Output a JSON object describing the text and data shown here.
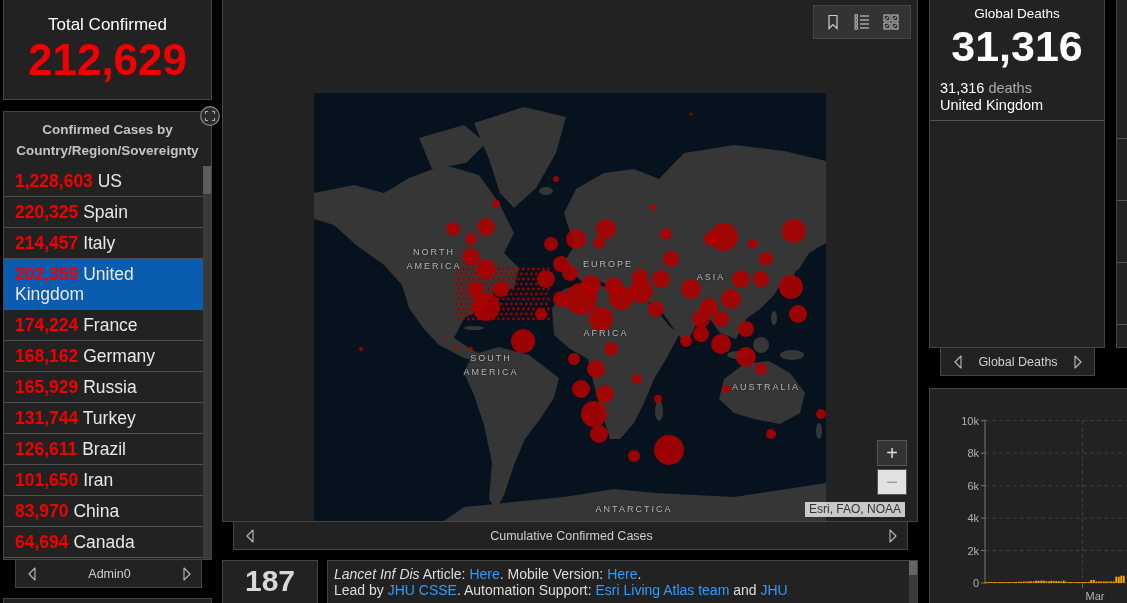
{
  "total_confirmed": {
    "label": "Total Confirmed",
    "value": "212,629"
  },
  "country_list": {
    "title": "Confirmed Cases by Country/Region/Sovereignty",
    "items": [
      {
        "count": "1,228,603",
        "name": "US",
        "selected": false
      },
      {
        "count": "220,325",
        "name": "Spain",
        "selected": false
      },
      {
        "count": "214,457",
        "name": "Italy",
        "selected": false
      },
      {
        "count": "202,359",
        "name": "United Kingdom",
        "selected": true
      },
      {
        "count": "174,224",
        "name": "France",
        "selected": false
      },
      {
        "count": "168,162",
        "name": "Germany",
        "selected": false
      },
      {
        "count": "165,929",
        "name": "Russia",
        "selected": false
      },
      {
        "count": "131,744",
        "name": "Turkey",
        "selected": false
      },
      {
        "count": "126,611",
        "name": "Brazil",
        "selected": false
      },
      {
        "count": "101,650",
        "name": "Iran",
        "selected": false
      },
      {
        "count": "83,970",
        "name": "China",
        "selected": false
      },
      {
        "count": "64,694",
        "name": "Canada",
        "selected": false
      }
    ],
    "tab": {
      "label": "Admin0"
    }
  },
  "map": {
    "labels": [
      "NORTH AMERICA",
      "EUROPE",
      "ASIA",
      "SOUTH AMERICA",
      "AFRICA",
      "AUSTRALIA",
      "ANTARCTICA"
    ],
    "zoom_buttons": [
      {
        "label": "+",
        "kind": "zoom-in"
      },
      {
        "label": "−",
        "kind": "zoom-out"
      }
    ],
    "attribution": "Esri, FAO, NOAA",
    "tab": {
      "label": "Cumulative Confirmed Cases"
    }
  },
  "bottom_count": {
    "value": "187"
  },
  "info_panel": {
    "lines": [
      [
        {
          "kind": "italic",
          "text": "Lancet Inf Dis"
        },
        {
          "kind": "plain",
          "text": " Article: "
        },
        {
          "kind": "link",
          "text": "Here"
        },
        {
          "kind": "plain",
          "text": ". Mobile Version: "
        },
        {
          "kind": "link",
          "text": "Here"
        },
        {
          "kind": "plain",
          "text": "."
        }
      ],
      [
        {
          "kind": "plain",
          "text": "Lead by "
        },
        {
          "kind": "link",
          "text": "JHU CSSE"
        },
        {
          "kind": "plain",
          "text": ". Automation Support: "
        },
        {
          "kind": "link",
          "text": "Esri Living Atlas team"
        },
        {
          "kind": "plain",
          "text": " and "
        },
        {
          "kind": "link",
          "text": "JHU"
        }
      ]
    ]
  },
  "global_deaths": {
    "title": "Global Deaths",
    "value": "31,316",
    "items": [
      {
        "count": "31,316",
        "unit": "deaths",
        "name": "United Kingdom"
      }
    ],
    "tab": {
      "label": "Global Deaths"
    }
  },
  "deaths_chart": {
    "y_axis_labels": [
      "10k",
      "8k",
      "6k",
      "4k",
      "2k",
      "0"
    ],
    "x_axis_labels": [
      "Mar"
    ]
  }
}
